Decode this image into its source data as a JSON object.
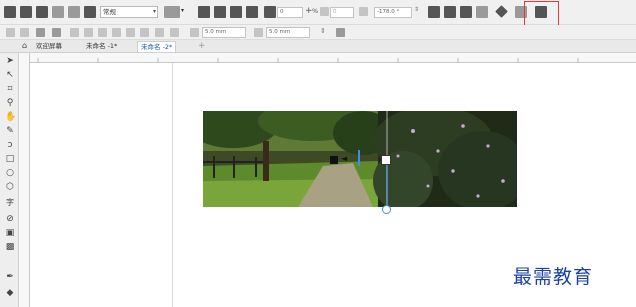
{
  "toolbar": {
    "style_combo_value": "常规",
    "outline_width_value": "0",
    "transparency_value": "0",
    "angle_value": "-178.0 °",
    "percent_symbol": "%"
  },
  "property_bar": {
    "width_value": "5.0 mm",
    "height_value": "5.0 mm"
  },
  "tabs": [
    {
      "label": "欢迎屏幕"
    },
    {
      "label": "未命名 -1*"
    },
    {
      "label": "未命名 -2*"
    }
  ],
  "new_tab_symbol": "+",
  "watermark": "最需教育",
  "colors": {
    "accent_red": "#e53935",
    "handle_blue": "#3b8fe0",
    "tab_active_text": "#1a56b8",
    "watermark_blue": "#1c3fa8"
  }
}
